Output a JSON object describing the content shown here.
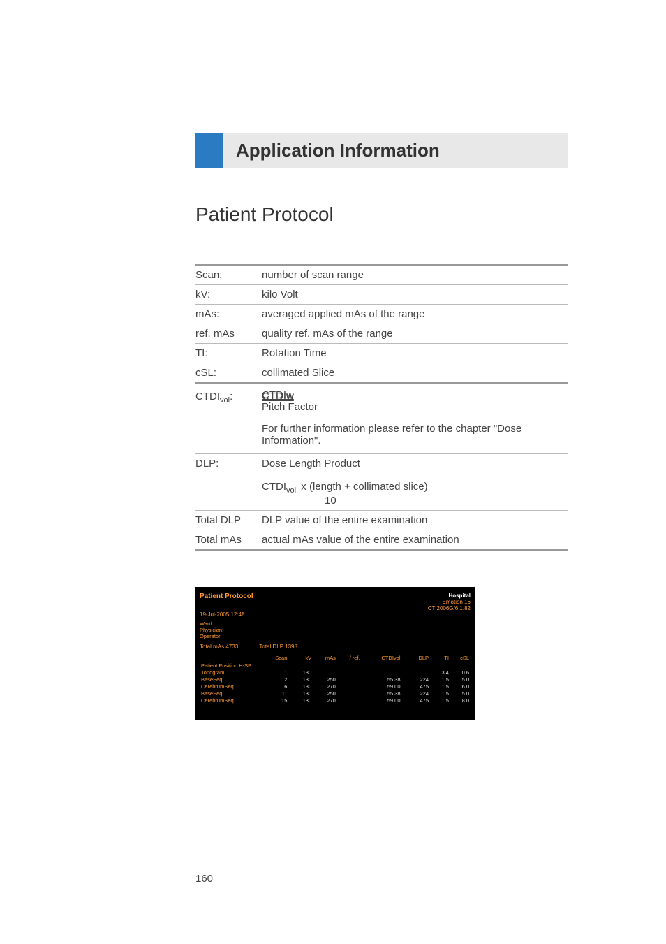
{
  "header": {
    "title": "Application Information"
  },
  "section": {
    "title": "Patient Protocol"
  },
  "definitions": [
    {
      "term": "Scan:",
      "desc": "number of scan range"
    },
    {
      "term": "kV:",
      "desc": "kilo Volt"
    },
    {
      "term": "mAs:",
      "desc": "averaged applied mAs of the range"
    },
    {
      "term": "ref. mAs",
      "desc": "quality ref. mAs of the range"
    },
    {
      "term": "TI:",
      "desc": "Rotation Time"
    },
    {
      "term": "cSL:",
      "desc": "collimated Slice"
    }
  ],
  "ctdi": {
    "term_prefix": "CTDI",
    "term_sub": "vol",
    "term_suffix": ":",
    "formula_top": "CTDIw",
    "formula_bottom": "Pitch Factor",
    "note": "For further information please refer to the chapter \"Dose Information\"."
  },
  "dlp": {
    "term": "DLP:",
    "desc": "Dose Length Product",
    "formula_top_prefix": "CTDI",
    "formula_top_sub": "vol.",
    "formula_top_mid": " x  (length + collimated slice)",
    "formula_bottom": "10"
  },
  "totals": [
    {
      "term": "Total DLP",
      "desc": "DLP value of the entire examination"
    },
    {
      "term": "Total mAs",
      "desc": "actual mAs value of the entire examination"
    }
  ],
  "screenshot": {
    "title": "Patient Protocol",
    "hospital": "Hospital",
    "system1": "Emotion 16",
    "system2": "CT 2006G/6.1.82",
    "date": "19-Jul-2005  12:48",
    "ward": "Ward:",
    "physician": "Physician:",
    "operator": "Operator:",
    "total_mas": "Total mAs 4733",
    "total_dlp": "Total DLP 1398",
    "headers": [
      "",
      "Scan",
      "kV",
      "mAs",
      "/ ref.",
      "CTDIvol",
      "DLP",
      "TI",
      "cSL"
    ],
    "patient_position": "Patient Position H-SP",
    "rows": [
      {
        "name": "Topogram",
        "scan": "1",
        "kv": "130",
        "mas": "",
        "ref": "",
        "ctdi": "",
        "dlp": "",
        "ti": "3.4",
        "csl": "0.6"
      },
      {
        "name": "BaseSeq",
        "scan": "2",
        "kv": "130",
        "mas": "250",
        "ref": "",
        "ctdi": "55.38",
        "dlp": "224",
        "ti": "1.5",
        "csl": "5.0"
      },
      {
        "name": "CerebrumSeq",
        "scan": "6",
        "kv": "130",
        "mas": "270",
        "ref": "",
        "ctdi": "59.00",
        "dlp": "475",
        "ti": "1.5",
        "csl": "6.0"
      },
      {
        "name": "BaseSeq",
        "scan": "11",
        "kv": "130",
        "mas": "250",
        "ref": "",
        "ctdi": "55.38",
        "dlp": "224",
        "ti": "1.5",
        "csl": "5.0"
      },
      {
        "name": "CerebrumSeq",
        "scan": "15",
        "kv": "130",
        "mas": "270",
        "ref": "",
        "ctdi": "59.00",
        "dlp": "475",
        "ti": "1.5",
        "csl": "8.0"
      }
    ]
  },
  "page_number": "160"
}
